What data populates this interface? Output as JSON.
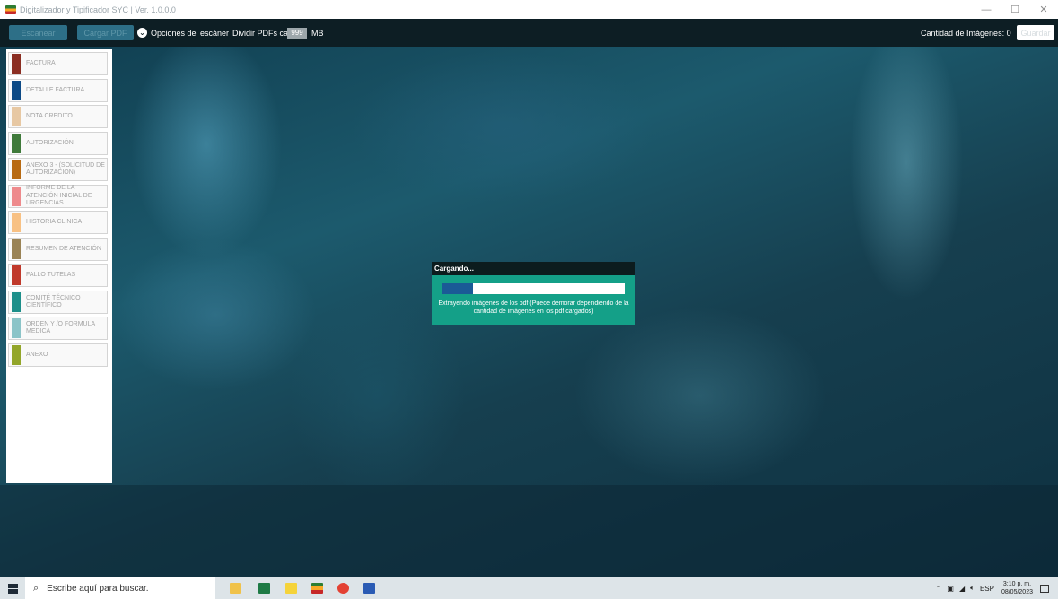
{
  "window": {
    "title": "Digitalizador y Tipificador SYC | Ver. 1.0.0.0",
    "minimize_label": "—",
    "maximize_label": "☐",
    "close_label": "✕"
  },
  "toolbar": {
    "scan_button_label": "Escanear",
    "load_button_label": "Cargar PDF",
    "scanner_options_label": "Opciones del escáner",
    "split_label": "Dividir PDFs cada",
    "split_value": "999",
    "split_unit": "MB",
    "image_count_label": "Cantidad de Imágenes: 0",
    "right_button_label": "Guardar"
  },
  "sidebar": {
    "items": [
      {
        "label": "FACTURA",
        "color": "#8b2e22"
      },
      {
        "label": "DETALLE FACTURA",
        "color": "#0d4a86"
      },
      {
        "label": "NOTA CREDITO",
        "color": "#e7c8a3"
      },
      {
        "label": "AUTORIZACIÓN",
        "color": "#3f7a3a"
      },
      {
        "label": "ANEXO 3 - (SOLICITUD DE AUTORIZACION)",
        "color": "#b86a12"
      },
      {
        "label": "INFORME DE LA ATENCIÓN INICIAL DE URGENCIAS",
        "color": "#ee8a8c"
      },
      {
        "label": "HISTORIA CLINICA",
        "color": "#f8c184"
      },
      {
        "label": "RESUMEN DE ATENCIÓN",
        "color": "#9a8355"
      },
      {
        "label": "FALLO TUTELAS",
        "color": "#c0392b"
      },
      {
        "label": "COMITÉ TÉCNICO CIENTÍFICO",
        "color": "#1d8f8a"
      },
      {
        "label": "ORDEN Y /O FORMULA MEDICA",
        "color": "#8bc4c8"
      },
      {
        "label": "ANEXO",
        "color": "#93a62a"
      }
    ]
  },
  "loading_dialog": {
    "title": "Cargando...",
    "progress": 0.17,
    "message": "Extrayendo imágenes de los pdf (Puede demorar dependiendo de la cantidad de imágenes en los pdf cargados)"
  },
  "taskbar": {
    "search_placeholder": "Escribe aquí para buscar.",
    "language": "ESP",
    "time": "3:10 p. m.",
    "date": "08/05/2023",
    "pinned_icons": [
      "file-explorer-icon",
      "excel-icon",
      "sticky-notes-icon",
      "app-icon",
      "chrome-icon",
      "word-icon"
    ]
  }
}
